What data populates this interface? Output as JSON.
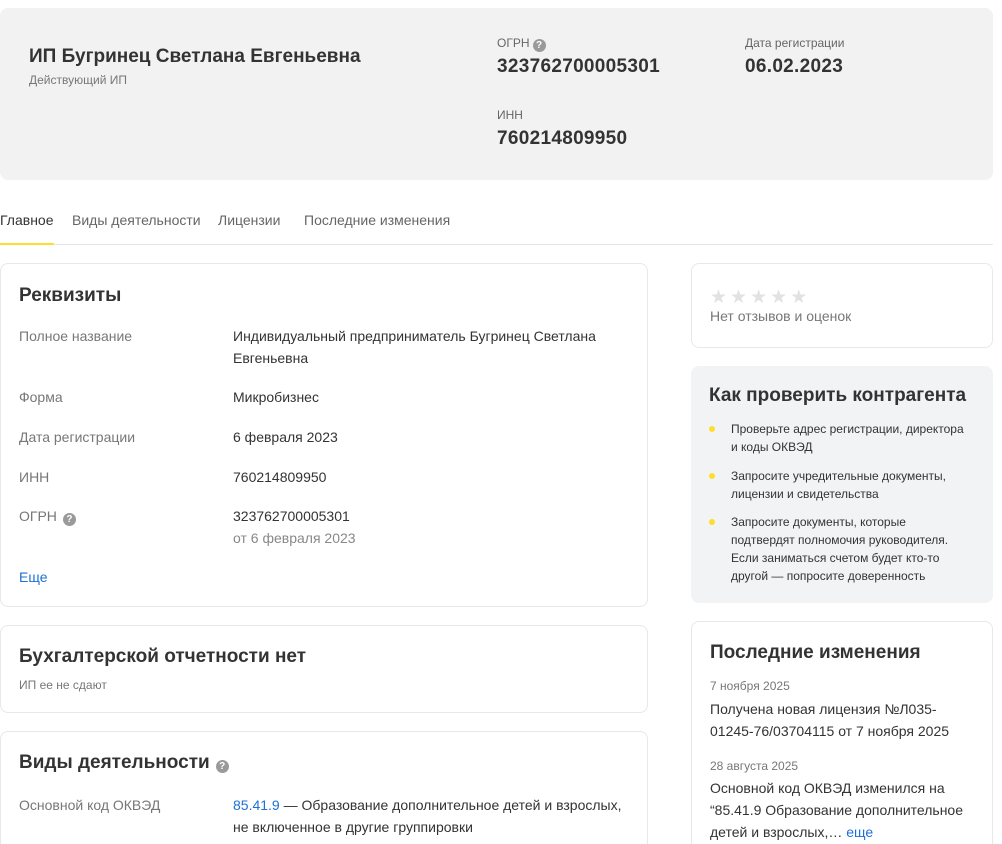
{
  "header": {
    "name": "ИП Бугринец Светлана Евгеньевна",
    "status": "Действующий ИП",
    "ogrn_label": "ОГРН",
    "ogrn_value": "323762700005301",
    "reg_label": "Дата регистрации",
    "reg_value": "06.02.2023",
    "inn_label": "ИНН",
    "inn_value": "760214809950"
  },
  "tabs": [
    {
      "label": "Главное",
      "active": true
    },
    {
      "label": "Виды деятельности",
      "active": false
    },
    {
      "label": "Лицензии",
      "active": false
    },
    {
      "label": "Последние изменения",
      "active": false
    }
  ],
  "requisites": {
    "title": "Реквизиты",
    "full_name_label": "Полное название",
    "full_name_value": "Индивидуальный предприниматель Бугринец Светлана Евгеньевна",
    "form_label": "Форма",
    "form_value": "Микробизнес",
    "reg_label": "Дата регистрации",
    "reg_value": "6 февраля 2023",
    "inn_label": "ИНН",
    "inn_value": "760214809950",
    "ogrn_label": "ОГРН",
    "ogrn_value": "323762700005301",
    "ogrn_sub": "от 6 февраля 2023",
    "more_link": "Еще"
  },
  "accounting": {
    "title": "Бухгалтерской отчетности нет",
    "subtitle": "ИП ее не сдают"
  },
  "activities": {
    "title": "Виды деятельности",
    "main_code_label": "Основной код ОКВЭД",
    "main_code": "85.41.9",
    "main_code_desc": " — Образование дополнительное детей и взрослых, не включенное в другие группировки"
  },
  "rating": {
    "stars_filled": 0,
    "stars_total": 5,
    "text": "Нет отзывов и оценок"
  },
  "check": {
    "title": "Как проверить контрагента",
    "items": [
      "Проверьте адрес регистрации, директора и коды ОКВЭД",
      "Запросите учредительные документы, лицензии и свидетельства",
      "Запросите документы, которые подтвердят полномочия руководителя. Если заниматься счетом будет кто-то другой — попросите доверенность"
    ]
  },
  "changes": {
    "title": "Последние изменения",
    "items": [
      {
        "date": "7 ноября 2025",
        "text": "Получена новая лицензия №Л035-01245-76/03704115 от 7 ноября 2025"
      },
      {
        "date": "28 августа 2025",
        "text": "Основной код ОКВЭД изменился на “85.41.9 Образование дополнительное детей и взрослых,…",
        "more": "еще"
      }
    ]
  },
  "colors": {
    "accent": "#ffdd2d",
    "link": "#1c72d4",
    "header_bg": "#f2f2f2"
  }
}
